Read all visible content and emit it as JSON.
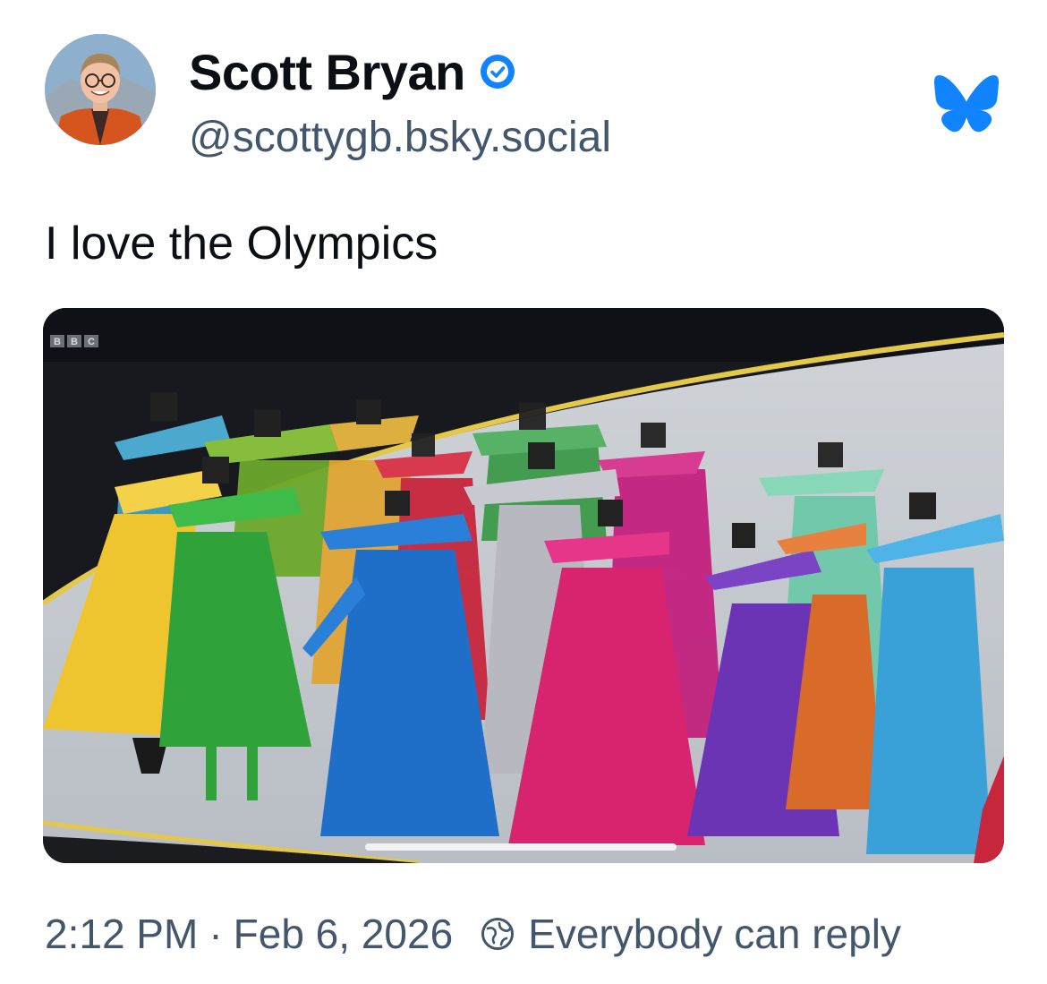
{
  "author": {
    "display_name": "Scott Bryan",
    "handle": "@scottygb.bsky.social",
    "avatar_icon": "avatar-photo",
    "verified_icon": "verified-check-icon"
  },
  "post": {
    "text": "I love the Olympics",
    "image": {
      "watermark": "BBC"
    }
  },
  "footer": {
    "time": "2:12 PM",
    "separator": "·",
    "date": "Feb 6, 2026",
    "reply_setting": "Everybody can reply",
    "reply_icon": "reply-settings-icon"
  },
  "brand": {
    "logo_icon": "bluesky-butterfly-icon",
    "accent_color": "#1083fe",
    "text_color": "#0b0f14",
    "secondary_text_color": "#42576c"
  }
}
